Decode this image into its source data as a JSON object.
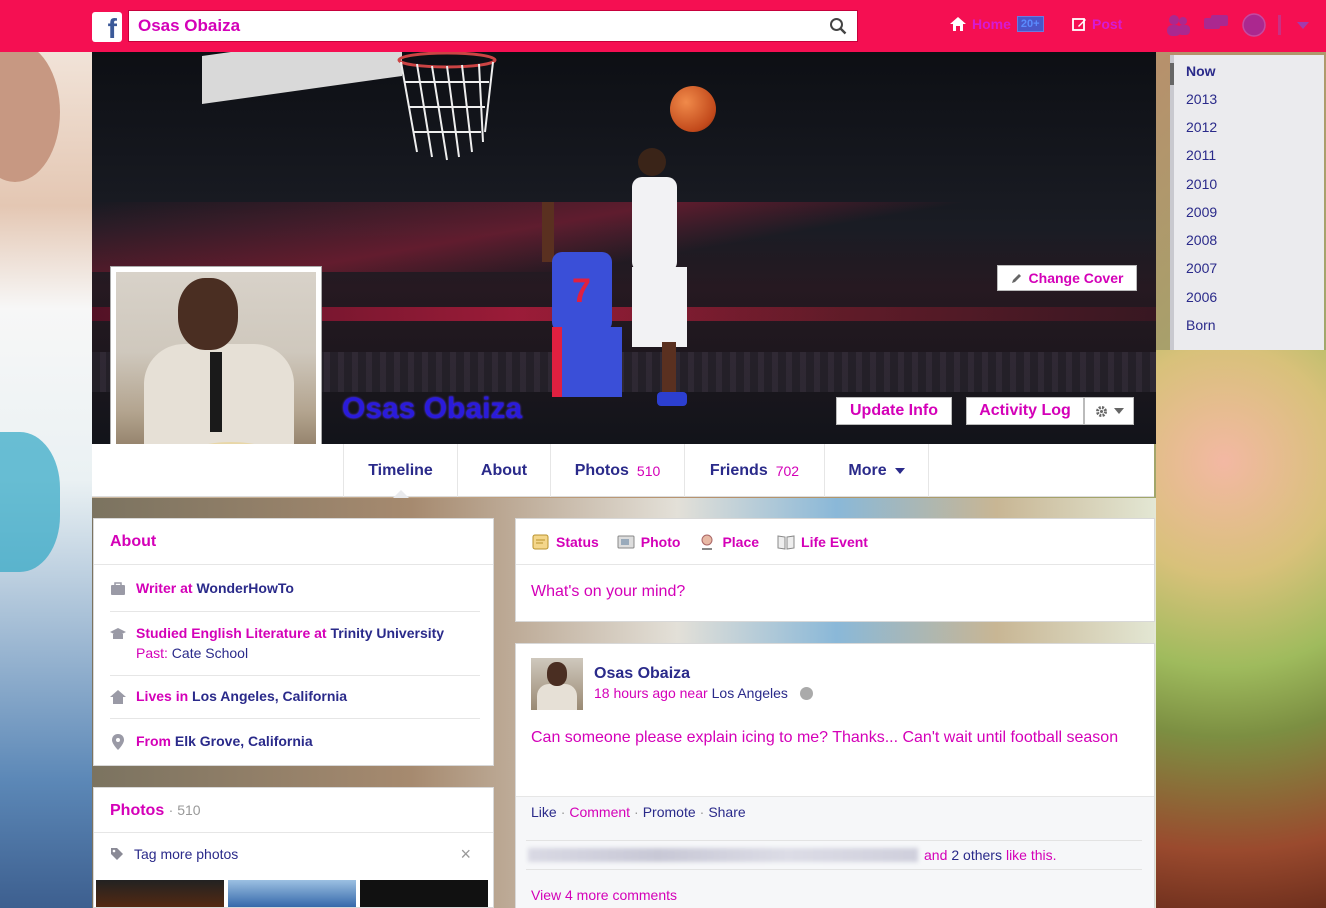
{
  "search": {
    "value": "Osas Obaiza"
  },
  "topnav": {
    "home_label": "Home",
    "home_count": "20+",
    "post_label": "Post"
  },
  "cover": {
    "name": "Osas Obaiza",
    "change_cover_label": "Change Cover",
    "update_info_label": "Update Info",
    "activity_log_label": "Activity Log"
  },
  "tabs": [
    {
      "label": "Timeline",
      "count": ""
    },
    {
      "label": "About",
      "count": ""
    },
    {
      "label": "Photos",
      "count": "510"
    },
    {
      "label": "Friends",
      "count": "702"
    },
    {
      "label": "More",
      "count": ""
    }
  ],
  "timeline_years": [
    "Now",
    "2013",
    "2012",
    "2011",
    "2010",
    "2009",
    "2008",
    "2007",
    "2006",
    "Born"
  ],
  "about": {
    "title": "About",
    "work": {
      "prefix": "Writer at",
      "place": "WonderHowTo"
    },
    "education": {
      "prefix": "Studied English Literature at",
      "place": "Trinity University",
      "past_prefix": "Past:",
      "past_place": "Cate School"
    },
    "lives": {
      "prefix": "Lives in",
      "place": "Los Angeles, California"
    },
    "from": {
      "prefix": "From",
      "place": "Elk Grove, California"
    }
  },
  "photos_box": {
    "title": "Photos",
    "count": "· 510",
    "tag_label": "Tag more photos",
    "close": "×"
  },
  "composer": {
    "tabs": [
      "Status",
      "Photo",
      "Place",
      "Life Event"
    ],
    "placeholder": "What's on your mind?"
  },
  "post": {
    "author": "Osas Obaiza",
    "time": "18 hours ago near",
    "location": "Los Angeles",
    "text": "Can someone please explain icing to me? Thanks... Can't wait until football season",
    "actions": {
      "like": "Like",
      "comment": "Comment",
      "promote": "Promote",
      "share": "Share",
      "sep": "·"
    },
    "likes": {
      "and": "and",
      "others": "2 others",
      "suffix": "like this."
    },
    "view_more": "View 4 more comments"
  },
  "colors": {
    "topbar": "#f50f52",
    "accent": "#d400b8",
    "link": "#2a2a8a"
  }
}
